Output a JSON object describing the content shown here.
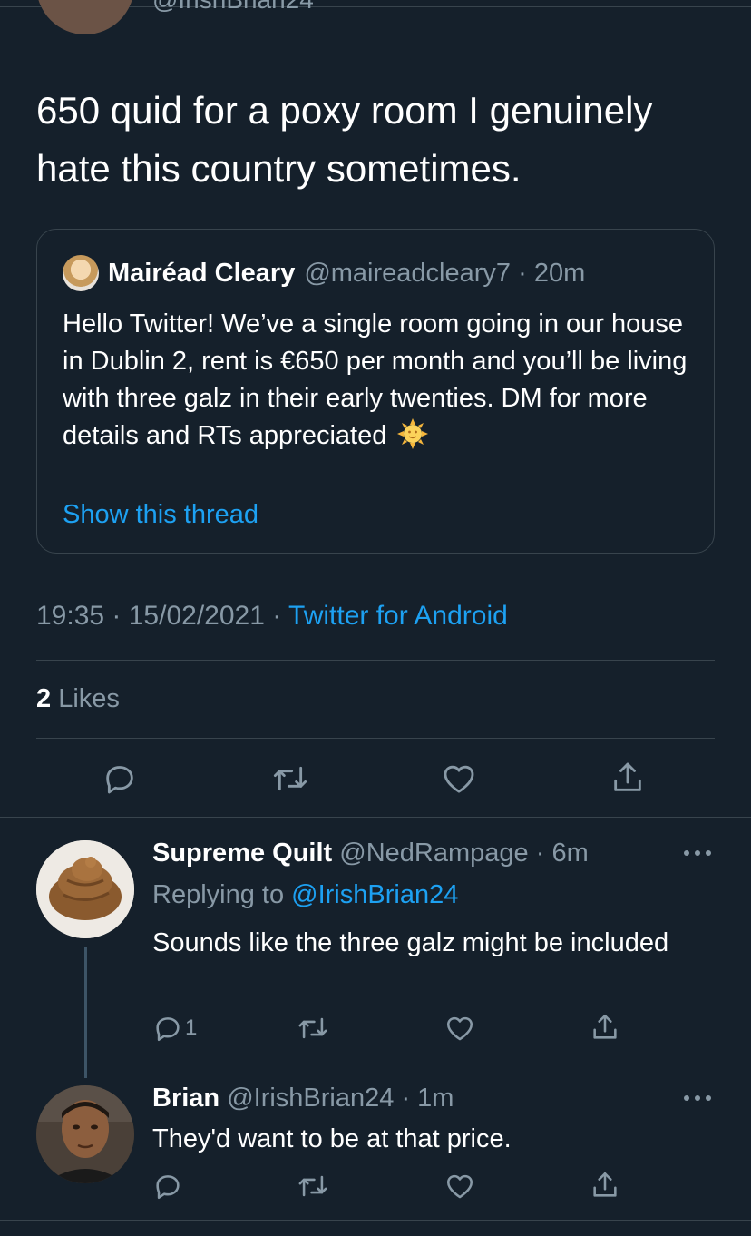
{
  "top": {
    "handle": "@IrishBrian24"
  },
  "tweet": {
    "text": "650 quid for a poxy room I genuinely hate this country sometimes.",
    "time": "19:35",
    "date": "15/02/2021",
    "source": "Twitter for Android",
    "likes_count": "2",
    "likes_label": "Likes"
  },
  "quote": {
    "name": "Mairéad Cleary",
    "handle": "@maireadcleary7",
    "age": "20m",
    "text": "Hello Twitter! We’ve a single room going in our house in Dublin 2, rent is €650 per month and you’ll be living with three galz in their early twenties. DM for more details and RTs appreciated",
    "emoji": "sun-with-face-icon",
    "show_thread": "Show this thread"
  },
  "replies": [
    {
      "name": "Supreme Quilt",
      "handle": "@NedRampage",
      "age": "6m",
      "replying_prefix": "Replying to",
      "replying_to": "@IrishBrian24",
      "text": "Sounds like the three galz might be included",
      "reply_count": "1"
    },
    {
      "name": "Brian",
      "handle": "@IrishBrian24",
      "age": "1m",
      "text": "They'd want to be at that price."
    }
  ],
  "colors": {
    "background": "#15202b",
    "accent": "#1da1f2",
    "muted": "#8899a6",
    "border": "#38444d"
  }
}
